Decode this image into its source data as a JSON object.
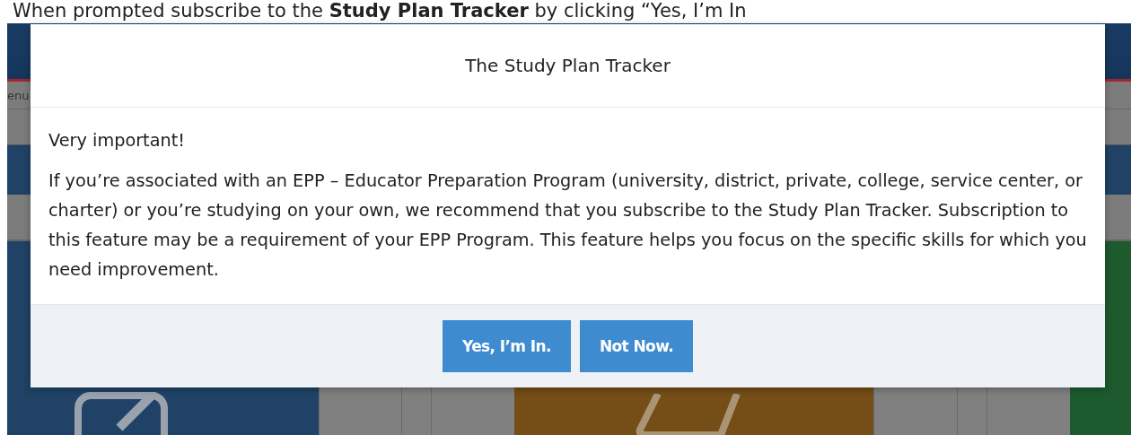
{
  "caption": "When prompted subscribe to the **Study Plan Tracker** by clicking “Yes, I’m In",
  "background": {
    "menu_text": "enu"
  },
  "modal": {
    "title": "The Study Plan Tracker",
    "heading": "Very important!",
    "body": "If you’re associated with an EPP – Educator Preparation Program (university, district, private, college, service center, or charter) or you’re studying on your own, we recommend that you subscribe to the Study Plan Tracker. Subscription to this feature may be a requirement of your EPP Program. This feature helps you focus on the specific skills for which you need improvement.",
    "buttons": [
      "Yes, I’m In.",
      "Not Now."
    ]
  }
}
